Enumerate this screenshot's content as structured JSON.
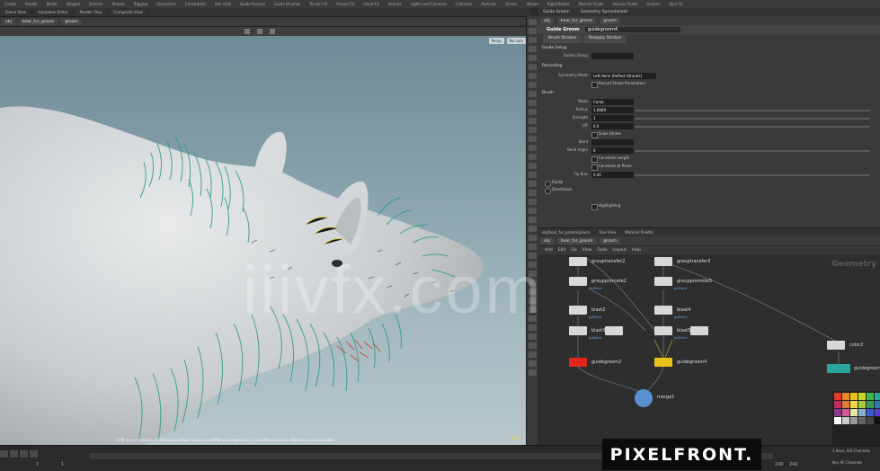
{
  "shelf": [
    "Create",
    "Modify",
    "Model",
    "Polygon",
    "Deform",
    "Texture",
    "Rigging",
    "Characters",
    "Constraints",
    "Hair Utils",
    "Guide Process",
    "Guide Brushes",
    "Terrain FX",
    "Simple FX",
    "Cloud FX",
    "Volume",
    "Lights and Cameras",
    "Collisions",
    "Particles",
    "Grains",
    "Vellum",
    "Rigid Bodies",
    "Particle Fluids",
    "Viscous Fluids",
    "Oceans",
    "Pyro FX"
  ],
  "viewport": {
    "tabs": [
      "Scene View",
      "Animation Editor",
      "Render View",
      "Composite View"
    ],
    "path": [
      "obj",
      "bear_fur_groom",
      "groom"
    ],
    "options": [
      "Persp",
      "No cam"
    ],
    "status": "LMB to paint guides. Shift-drag to adjust radius. Use MMB to change brush. Ctrl-LMB to smooth. Hold Alt to select guides.",
    "fps": "60fps"
  },
  "params": {
    "tabs_top": [
      "Guide Groom",
      "Geometry Spreadsheet"
    ],
    "path": [
      "obj",
      "bear_fur_groom",
      "groom"
    ],
    "node_type": "Guide Groom",
    "node_name": "guidegroom4",
    "sub_tabs": [
      "Brush Strokes",
      "Reapply Strokes"
    ],
    "sections": [
      "Guide Setup",
      "Recording",
      "Brush"
    ],
    "rows": [
      {
        "label": "Guides Group",
        "type": "field",
        "value": ""
      },
      {
        "label": "Symmetry Mode",
        "type": "field",
        "value": "Left Hemi (Reflect Strands)"
      },
      {
        "label": "",
        "type": "check",
        "value": "Record Stroke Parameters"
      },
      {
        "label": "Mode",
        "type": "field",
        "value": "Comb"
      },
      {
        "label": "Radius",
        "type": "field",
        "value": "1.0669"
      },
      {
        "label": "Strength",
        "type": "field",
        "value": "1"
      },
      {
        "label": "Lift",
        "type": "field",
        "value": "0.5"
      },
      {
        "label": "",
        "type": "check",
        "value": "Scale Stroke"
      },
      {
        "label": "Bend",
        "type": "field",
        "value": ""
      },
      {
        "label": "Bend Angle",
        "type": "field",
        "value": "0"
      },
      {
        "label": "",
        "type": "check",
        "value": "Constrain Length"
      },
      {
        "label": "",
        "type": "check",
        "value": "Constrain to Plane"
      },
      {
        "label": "Tip Bias",
        "type": "field",
        "value": "0.41"
      },
      {
        "label": "",
        "type": "radio",
        "value": "Radial"
      },
      {
        "label": "",
        "type": "radio",
        "value": "Directional"
      },
      {
        "label": "",
        "type": "check",
        "value": "Highlighting"
      }
    ]
  },
  "network": {
    "tabs": [
      "obj/bear_fur_groom/groom",
      "Tree View",
      "Material Palette"
    ],
    "path": [
      "obj",
      "bear_fur_groom",
      "groom"
    ],
    "menu": [
      "Add",
      "Edit",
      "Go",
      "View",
      "Tools",
      "Layout",
      "Help"
    ],
    "context_label": "Geometry",
    "nodes": [
      {
        "name": "grouptransfer2",
        "sub": ""
      },
      {
        "name": "grouppromote2",
        "sub": "guiPoint"
      },
      {
        "name": "blast2",
        "sub": "guiPoint"
      },
      {
        "name": "blast3",
        "sub": "guiPoint"
      },
      {
        "name": "guidegroom2",
        "sub": ""
      },
      {
        "name": "grouptransfer3",
        "sub": ""
      },
      {
        "name": "grouppromote3",
        "sub": "guiPoint"
      },
      {
        "name": "blast4",
        "sub": "guiPoint"
      },
      {
        "name": "blast5",
        "sub": "guiPoint"
      },
      {
        "name": "guidegroom4",
        "sub": ""
      },
      {
        "name": "merge1",
        "sub": ""
      },
      {
        "name": "color2",
        "sub": ""
      },
      {
        "name": "guidegroom",
        "sub": ""
      }
    ]
  },
  "timeline": {
    "start": "1",
    "current": "1",
    "end": "240",
    "end2": "240"
  },
  "corner_info": [
    "1 Keys, 0/0 Channels",
    "Key All Channels"
  ],
  "badge": "PIXELFRONT.",
  "watermark": "iiivfx.com",
  "colors": {
    "accent_red": "#e1271c",
    "accent_yellow": "#e8c21a",
    "accent_teal": "#2aa79b",
    "guide_teal": "#2a9a8a"
  }
}
